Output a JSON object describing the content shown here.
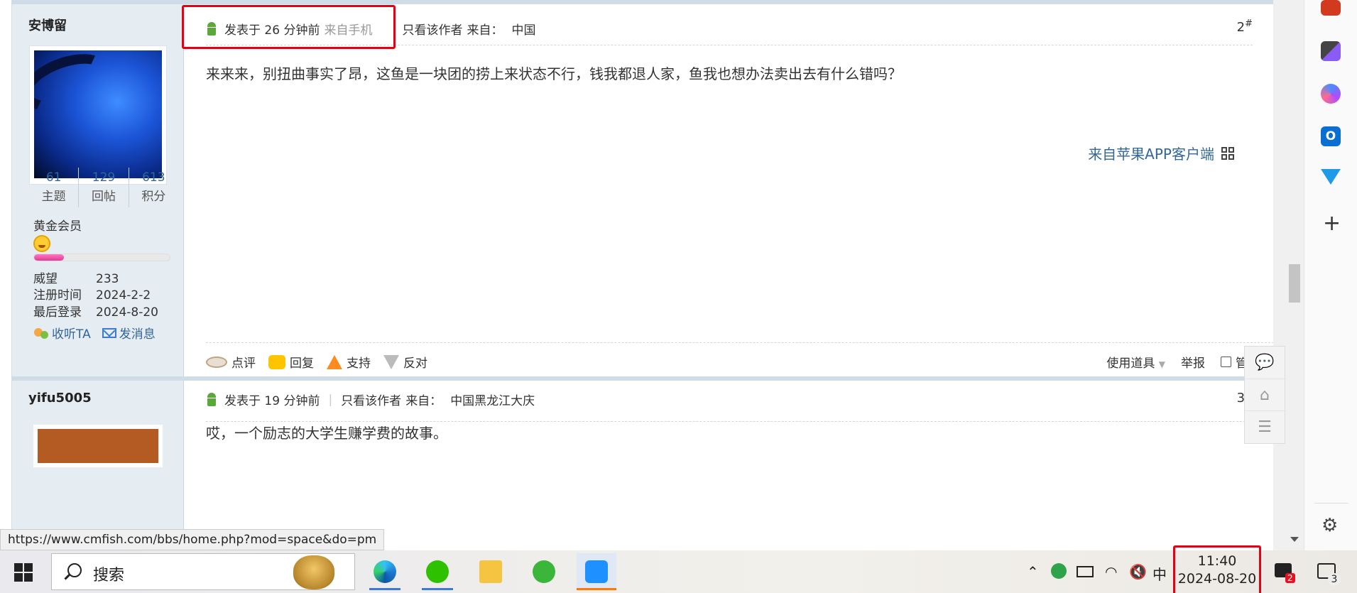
{
  "post2": {
    "author": "安博留",
    "stats": [
      {
        "num": "61",
        "label": "主题"
      },
      {
        "num": "129",
        "label": "回帖"
      },
      {
        "num": "613",
        "label": "积分"
      }
    ],
    "rank": "黄金会员",
    "level_progress": 0.22,
    "info": [
      {
        "key": "威望",
        "value": "233"
      },
      {
        "key": "注册时间",
        "value": "2024-2-2"
      },
      {
        "key": "最后登录",
        "value": "2024-8-20"
      }
    ],
    "follow_label": "收听TA",
    "message_label": "发消息",
    "posted": "发表于 26 分钟前",
    "via": "来自手机",
    "only_author": "只看该作者",
    "from_label": "来自：",
    "location": "中国",
    "floor": "2",
    "floor_mark": "#",
    "content": "来来来，别扭曲事实了昂，这鱼是一块团的捞上来状态不行，钱我都退人家，鱼我也想办法卖出去有什么错吗？",
    "from_app": "来自苹果APP客户端",
    "actions": {
      "comment": "点评",
      "reply": "回复",
      "support": "支持",
      "oppose": "反对"
    },
    "tools": "使用道具",
    "report": "举报",
    "manage": "管理"
  },
  "post3": {
    "author": "yifu5005",
    "posted": "发表于 19 分钟前",
    "only_author": "只看该作者",
    "from_label": "来自：",
    "location": "中国黑龙江大庆",
    "floor": "3",
    "floor_mark": "#",
    "content": "哎，一个励志的大学生赚学费的故事。"
  },
  "status_url": "https://www.cmfish.com/bbs/home.php?mod=space&do=pm",
  "taskbar": {
    "search_placeholder": "搜索",
    "ime": "中",
    "time": "11:40",
    "date": "2024-08-20",
    "badge_count": "2",
    "notif_count": "3"
  },
  "colors": {
    "link": "#336699",
    "highlight_box": "#e60012",
    "sidebar_bg": "#e5edf2"
  }
}
